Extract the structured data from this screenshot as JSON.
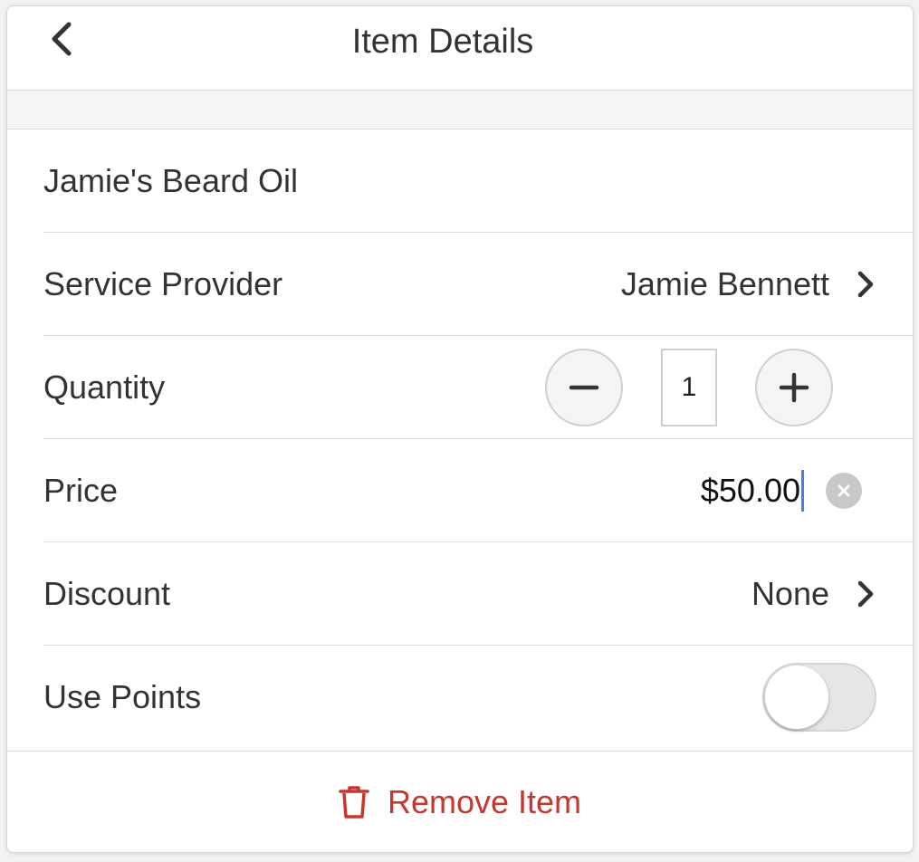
{
  "header": {
    "title": "Item Details",
    "back_icon": "chevron-left-icon"
  },
  "item": {
    "name": "Jamie's Beard Oil"
  },
  "service_provider": {
    "label": "Service Provider",
    "value": "Jamie Bennett"
  },
  "quantity": {
    "label": "Quantity",
    "value": "1",
    "decrement_icon": "minus-icon",
    "increment_icon": "plus-icon"
  },
  "price": {
    "label": "Price",
    "value": "$50.00",
    "clear_icon": "clear-icon"
  },
  "discount": {
    "label": "Discount",
    "value": "None"
  },
  "use_points": {
    "label": "Use Points",
    "enabled": false
  },
  "footer": {
    "remove_label": "Remove Item",
    "remove_icon": "trash-icon"
  },
  "colors": {
    "danger": "#c8372d",
    "caret": "#4a7cf0",
    "text": "#333333"
  }
}
